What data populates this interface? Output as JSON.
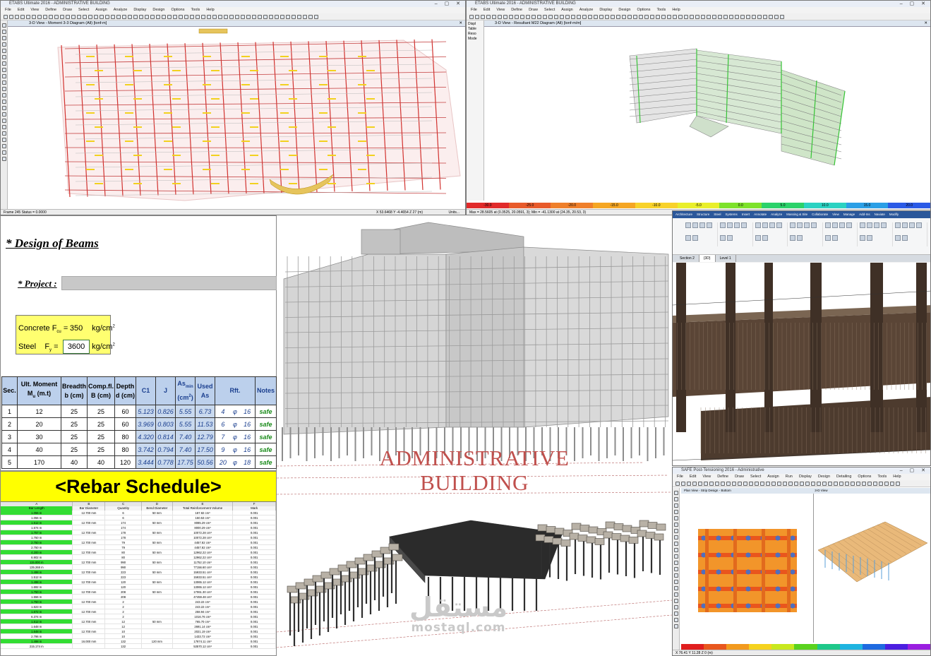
{
  "etabs_left": {
    "title": "ETABS Ultimate 2016 - ADMINISTRATIVE BUILDING",
    "menus": [
      "File",
      "Edit",
      "View",
      "Define",
      "Draw",
      "Select",
      "Assign",
      "Analyze",
      "Display",
      "Design",
      "Options",
      "Tools",
      "Help"
    ],
    "tab_label": "3-D View - Moment 3-3 Diagram (All) [tonf-m]",
    "side_labels": [
      "Ungl",
      "Ungl",
      "Ungl"
    ],
    "status_left": "Frame 245 Status = 0.0000",
    "status_right": "X 53.6468 Y -4.4654 Z 27 (m)",
    "status_units": "Units..."
  },
  "etabs_right": {
    "title": "ETABS Ultimate 2016 - ADMINISTRATIVE BUILDING",
    "menus": [
      "File",
      "Edit",
      "View",
      "Define",
      "Draw",
      "Select",
      "Assign",
      "Analyze",
      "Display",
      "Design",
      "Options",
      "Tools",
      "Help"
    ],
    "tab_label": "3-D View - Resultant M22 Diagram (All) [tonf-m/m]",
    "side_labels": [
      "Displ",
      "Table",
      "Reso",
      "Mode"
    ],
    "legend_values": [
      "-30.0",
      "-25.0",
      "-20.0",
      "-15.0",
      "-10.0",
      "-5.0",
      "0.0",
      "5.0",
      "10.0",
      "15.0",
      "20.0"
    ],
    "legend_colors": [
      "#e12a2a",
      "#e85a2a",
      "#ef7f2a",
      "#f5a623",
      "#f8d22a",
      "#e9ef2a",
      "#7de22a",
      "#2ad26a",
      "#2ad2c2",
      "#2a9fe6",
      "#2a5ae6"
    ],
    "status_left": "Max = 28.5605 at (0.3525, 20.0591, 3); Min = -41.1300 at (24.35, 20.53, 3)"
  },
  "beam_design": {
    "title": "* Design of Beams",
    "project_label": "* Project :",
    "project_value": "",
    "concrete_label": "Concrete F",
    "concrete_sub": "cu",
    "concrete_value": "350",
    "steel_label": "Steel",
    "steel_f": "F",
    "steel_sub": "y",
    "steel_value": "3600",
    "unit": "kg/cm",
    "unit_sup": "2",
    "headers": {
      "sec": "Sec.",
      "moment_1": "Ult. Moment",
      "moment_2": "M",
      "moment_sub": "u",
      "moment_unit": "(m.t)",
      "breadth_1": "Breadth",
      "breadth_2": "b (cm)",
      "compfl_1": "Comp.fl.",
      "compfl_2": "B (cm)",
      "depth_1": "Depth",
      "depth_2": "d (cm)",
      "c1": "C1",
      "j": "J",
      "asmin_1": "As",
      "asmin_sub": "min",
      "asmin_2": "(cm",
      "asmin_sup": "2",
      "used_1": "Used",
      "used_2": "As",
      "rft": "Rft.",
      "notes": "Notes"
    },
    "rows": [
      {
        "sec": "1",
        "mu": "12",
        "b": "25",
        "B": "25",
        "d": "60",
        "c1": "5.123",
        "j": "0.826",
        "asmin": "5.55",
        "as": "6.73",
        "n": "4",
        "phi": "φ",
        "dia": "16",
        "note": "safe"
      },
      {
        "sec": "2",
        "mu": "20",
        "b": "25",
        "B": "25",
        "d": "60",
        "c1": "3.969",
        "j": "0.803",
        "asmin": "5.55",
        "as": "11.53",
        "n": "6",
        "phi": "φ",
        "dia": "16",
        "note": "safe"
      },
      {
        "sec": "3",
        "mu": "30",
        "b": "25",
        "B": "25",
        "d": "80",
        "c1": "4.320",
        "j": "0.814",
        "asmin": "7.40",
        "as": "12.79",
        "n": "7",
        "phi": "φ",
        "dia": "16",
        "note": "safe"
      },
      {
        "sec": "4",
        "mu": "40",
        "b": "25",
        "B": "25",
        "d": "80",
        "c1": "3.742",
        "j": "0.794",
        "asmin": "7.40",
        "as": "17.50",
        "n": "9",
        "phi": "φ",
        "dia": "16",
        "note": "safe"
      },
      {
        "sec": "5",
        "mu": "170",
        "b": "40",
        "B": "40",
        "d": "120",
        "c1": "3.444",
        "j": "0.778",
        "asmin": "17.75",
        "as": "50.56",
        "n": "20",
        "phi": "φ",
        "dia": "18",
        "note": "safe"
      }
    ]
  },
  "rebar_schedule": {
    "title": "<Rebar Schedule>",
    "col_letters": [
      "A",
      "B",
      "C",
      "D",
      "E",
      "F"
    ],
    "col_names": [
      "Bar Length",
      "Bar Diameter",
      "Quantity",
      "Bend Diameter",
      "Total Reinforcement Volume",
      "Mark"
    ],
    "rows": [
      {
        "len": "1.056 m",
        "dia": "12.700 mm",
        "qty": "6",
        "bend": "50 mm",
        "vol": "187.82 cm³",
        "mark": "0.001",
        "green": true
      },
      {
        "len": "1.056 m",
        "dia": "",
        "qty": "6",
        "bend": "",
        "vol": "150.53 cm³",
        "mark": "0.001",
        "green": false
      },
      {
        "len": "1.512 m",
        "dia": "12.700 mm",
        "qty": "174",
        "bend": "50 mm",
        "vol": "8085.29 cm³",
        "mark": "0.001",
        "green": true
      },
      {
        "len": "1.574 m",
        "dia": "",
        "qty": "174",
        "bend": "",
        "vol": "8000.29 cm³",
        "mark": "0.001",
        "green": false
      },
      {
        "len": "1.757 m",
        "dia": "12.700 mm",
        "qty": "178",
        "bend": "50 mm",
        "vol": "10072.28 cm³",
        "mark": "0.001",
        "green": true
      },
      {
        "len": "1.750 m",
        "dia": "",
        "qty": "178",
        "bend": "",
        "vol": "10072.28 cm³",
        "mark": "0.001",
        "green": false
      },
      {
        "len": "2.750 m",
        "dia": "12.700 mm",
        "qty": "79",
        "bend": "50 mm",
        "vol": "4457.82 cm³",
        "mark": "0.001",
        "green": true
      },
      {
        "len": "2.750 m",
        "dia": "",
        "qty": "79",
        "bend": "",
        "vol": "4457.82 cm³",
        "mark": "0.001",
        "green": false
      },
      {
        "len": "4.200 m",
        "dia": "12.700 mm",
        "qty": "80",
        "bend": "50 mm",
        "vol": "12962.22 cm³",
        "mark": "0.001",
        "green": true
      },
      {
        "len": "6.902 m",
        "dia": "",
        "qty": "80",
        "bend": "",
        "vol": "12962.22 cm³",
        "mark": "0.001",
        "green": false
      },
      {
        "len": "115.000 m",
        "dia": "12.700 mm",
        "qty": "990",
        "bend": "50 mm",
        "vol": "11752.10 cm³",
        "mark": "0.001",
        "green": true
      },
      {
        "len": "135.268 m",
        "dia": "",
        "qty": "990",
        "bend": "",
        "vol": "77156.60 cm³",
        "mark": "0.001",
        "green": false
      },
      {
        "len": "1.498 m",
        "dia": "12.700 mm",
        "qty": "223",
        "bend": "50 mm",
        "vol": "15933.51 cm³",
        "mark": "0.001",
        "green": true
      },
      {
        "len": "1.512 m",
        "dia": "",
        "qty": "223",
        "bend": "",
        "vol": "15933.51 cm³",
        "mark": "0.001",
        "green": false
      },
      {
        "len": "1.498 m",
        "dia": "12.700 mm",
        "qty": "120",
        "bend": "50 mm",
        "vol": "13065.12 cm³",
        "mark": "0.001",
        "green": true
      },
      {
        "len": "1.692 m",
        "dia": "",
        "qty": "120",
        "bend": "",
        "vol": "13065.12 cm³",
        "mark": "0.001",
        "green": false
      },
      {
        "len": "1.750 m",
        "dia": "12.700 mm",
        "qty": "208",
        "bend": "50 mm",
        "vol": "17061.30 cm³",
        "mark": "0.001",
        "green": true
      },
      {
        "len": "1.556 m",
        "dia": "",
        "qty": "208",
        "bend": "",
        "vol": "47459.48 cm³",
        "mark": "0.001",
        "green": false
      },
      {
        "len": "1.750 m",
        "dia": "12.700 mm",
        "qty": "2",
        "bend": "",
        "vol": "243.22 cm³",
        "mark": "0.001",
        "green": true
      },
      {
        "len": "1.623 m",
        "dia": "",
        "qty": "2",
        "bend": "",
        "vol": "243.22 cm³",
        "mark": "0.001",
        "green": false
      },
      {
        "len": "1.672 m",
        "dia": "12.700 mm",
        "qty": "2",
        "bend": "",
        "vol": "258.94 cm³",
        "mark": "0.001",
        "green": true
      },
      {
        "len": "6.374 m",
        "dia": "",
        "qty": "2",
        "bend": "",
        "vol": "1016.76 cm³",
        "mark": "0.001",
        "green": false
      },
      {
        "len": "1.512 m",
        "dia": "12.700 mm",
        "qty": "12",
        "bend": "50 mm",
        "vol": "765.70 cm³",
        "mark": "0.001",
        "green": true
      },
      {
        "len": "1.648 m",
        "dia": "",
        "qty": "12",
        "bend": "",
        "vol": "2691.14 cm³",
        "mark": "0.001",
        "green": false
      },
      {
        "len": "1.648 m",
        "dia": "12.700 mm",
        "qty": "10",
        "bend": "",
        "vol": "2021.19 cm³",
        "mark": "0.001",
        "green": true
      },
      {
        "len": "2.796 m",
        "dia": "",
        "qty": "10",
        "bend": "",
        "vol": "1433.72 cm³",
        "mark": "0.001",
        "green": false
      },
      {
        "len": "1.498 m",
        "dia": "16.000 mm",
        "qty": "132",
        "bend": "120 mm",
        "vol": "17874.11 cm³",
        "mark": "0.001",
        "green": true
      },
      {
        "len": "215.174 m",
        "dia": "",
        "qty": "132",
        "bend": "",
        "vol": "53570.12 cm³",
        "mark": "0.001",
        "green": false
      }
    ]
  },
  "center_render": {
    "title_line1": "ADMINISTRATIVE",
    "title_line2": "BUILDING",
    "watermark_ar": "مستقل",
    "watermark_lat": "mostaql.com"
  },
  "revit": {
    "ribbon_tabs": [
      "Architecture",
      "Structure",
      "Steel",
      "Systems",
      "Insert",
      "Annotate",
      "Analyze",
      "Massing & Site",
      "Collaborate",
      "View",
      "Manage",
      "Add-Ins",
      "Naviate",
      "Modify"
    ],
    "view_tabs": [
      "Section 2",
      "{3D}",
      "Level 1"
    ]
  },
  "safe": {
    "title": "SAFE Post-Tensioning 2016 - Administrative",
    "menus": [
      "File",
      "Edit",
      "View",
      "Define",
      "Draw",
      "Select",
      "Assign",
      "Run",
      "Display",
      "Design",
      "Detailing",
      "Options",
      "Tools",
      "Help"
    ],
    "tab_left": "Plan View - Strip Design - Bottom",
    "tab_right": "3-D View",
    "status": "X 76.41 Y 11.28 Z 0 (m)"
  }
}
